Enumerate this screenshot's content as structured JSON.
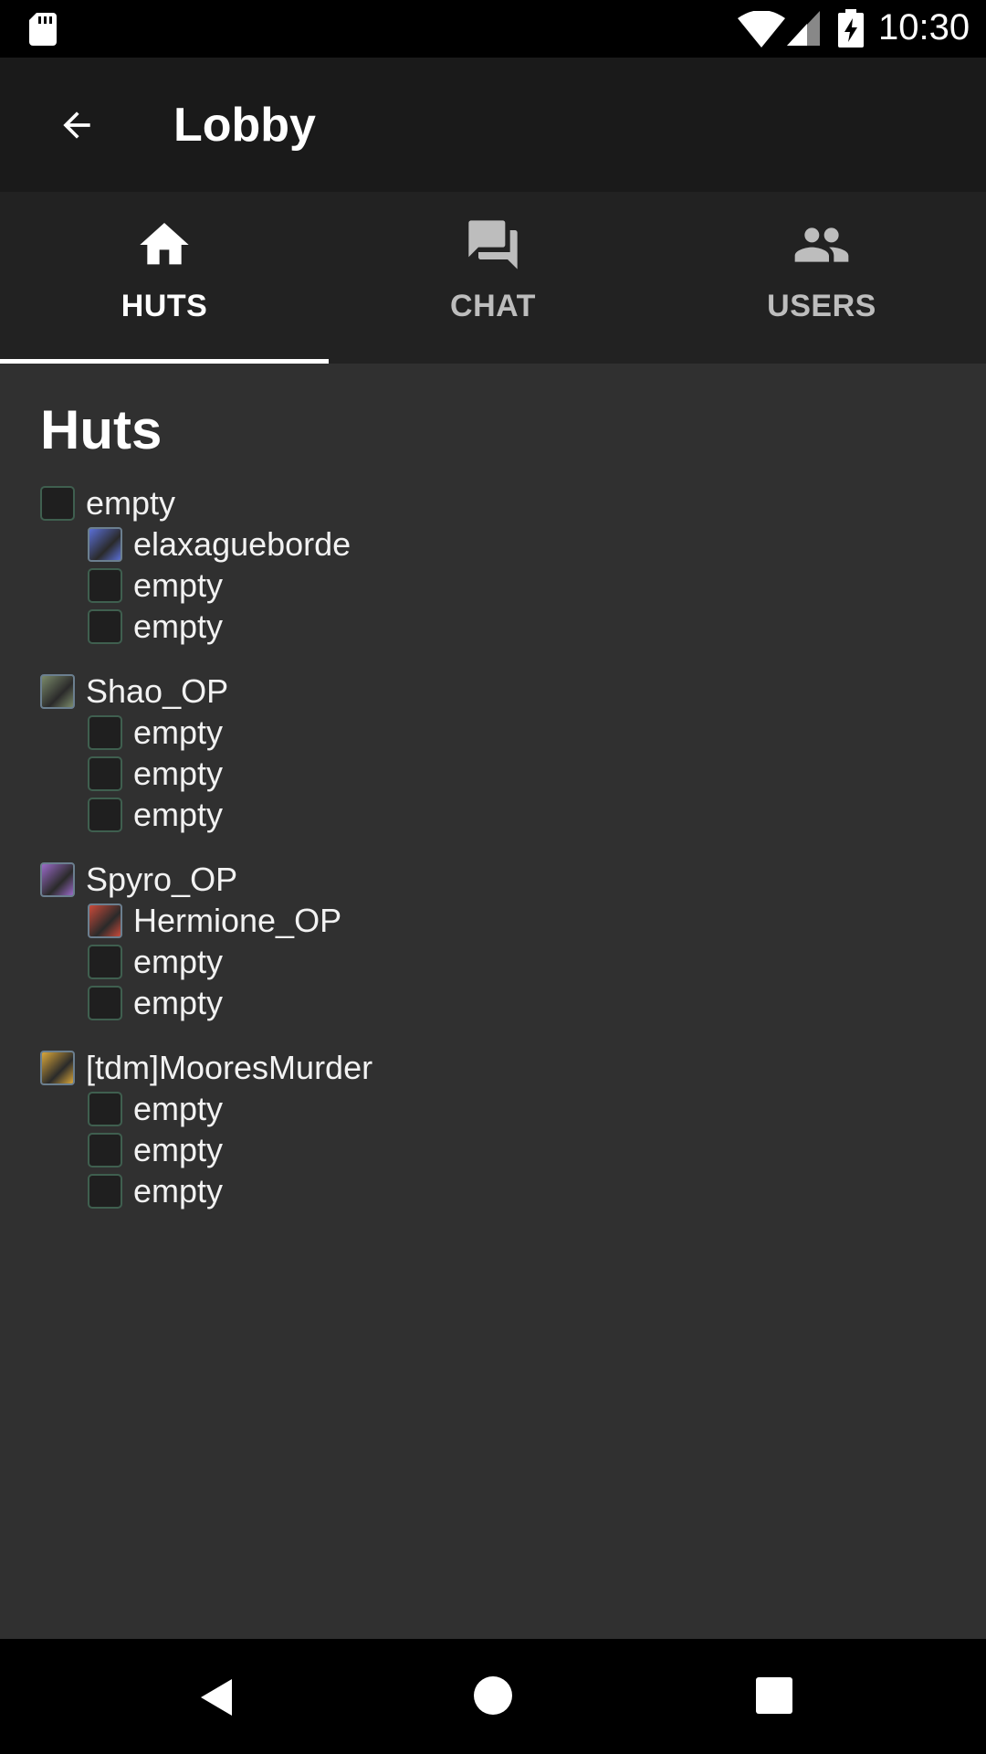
{
  "status_bar": {
    "time": "10:30",
    "icons": [
      "sd-card-icon",
      "wifi-icon",
      "signal-icon",
      "battery-charging-icon"
    ]
  },
  "app_bar": {
    "title": "Lobby",
    "back_icon": "arrow-back-icon"
  },
  "tabs": [
    {
      "label": "HUTS",
      "icon": "home-icon",
      "selected": true
    },
    {
      "label": "CHAT",
      "icon": "chat-icon",
      "selected": false
    },
    {
      "label": "USERS",
      "icon": "users-icon",
      "selected": false
    }
  ],
  "section_title": "Huts",
  "huts": [
    {
      "owner": {
        "name": "empty",
        "avatar": null
      },
      "members": [
        {
          "name": "elaxagueborde",
          "avatar": "#5a6fd6"
        },
        {
          "name": "empty",
          "avatar": null
        },
        {
          "name": "empty",
          "avatar": null
        }
      ]
    },
    {
      "owner": {
        "name": "Shao_OP",
        "avatar": "#7b8a6a"
      },
      "members": [
        {
          "name": "empty",
          "avatar": null
        },
        {
          "name": "empty",
          "avatar": null
        },
        {
          "name": "empty",
          "avatar": null
        }
      ]
    },
    {
      "owner": {
        "name": "Spyro_OP",
        "avatar": "#9a6ac8"
      },
      "members": [
        {
          "name": "Hermione_OP",
          "avatar": "#c94a3a"
        },
        {
          "name": "empty",
          "avatar": null
        },
        {
          "name": "empty",
          "avatar": null
        }
      ]
    },
    {
      "owner": {
        "name": "[tdm]MooresMurder",
        "avatar": "#d9a63a"
      },
      "members": [
        {
          "name": "empty",
          "avatar": null
        },
        {
          "name": "empty",
          "avatar": null
        },
        {
          "name": "empty",
          "avatar": null
        }
      ]
    }
  ],
  "nav_bar": {
    "icons": [
      "nav-back-icon",
      "nav-home-icon",
      "nav-recents-icon"
    ]
  }
}
